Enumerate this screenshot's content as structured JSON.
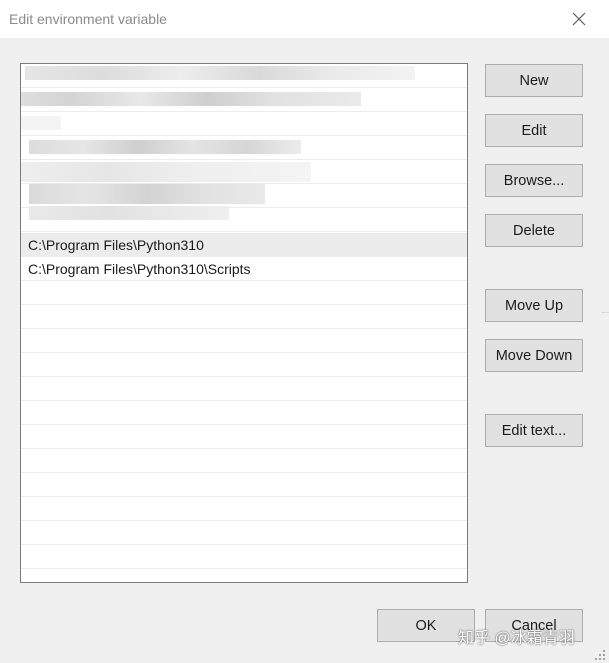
{
  "window": {
    "title": "Edit environment variable"
  },
  "list": {
    "entries": [
      "",
      "",
      "",
      "",
      "",
      "",
      "",
      "C:\\Program Files\\Python310",
      "C:\\Program Files\\Python310\\Scripts"
    ],
    "selected_index": 7
  },
  "buttons": {
    "new": "New",
    "edit": "Edit",
    "browse": "Browse...",
    "delete": "Delete",
    "move_up": "Move Up",
    "move_down": "Move Down",
    "edit_text": "Edit text...",
    "ok": "OK",
    "cancel": "Cancel"
  },
  "watermark": {
    "text": "知乎 @冰霜青羽"
  },
  "colors": {
    "window_bg": "#f0f0f0",
    "titlebar_bg": "#ffffff",
    "selected_row": "#ececec",
    "button_bg": "#e1e1e1",
    "button_border": "#adadad"
  }
}
